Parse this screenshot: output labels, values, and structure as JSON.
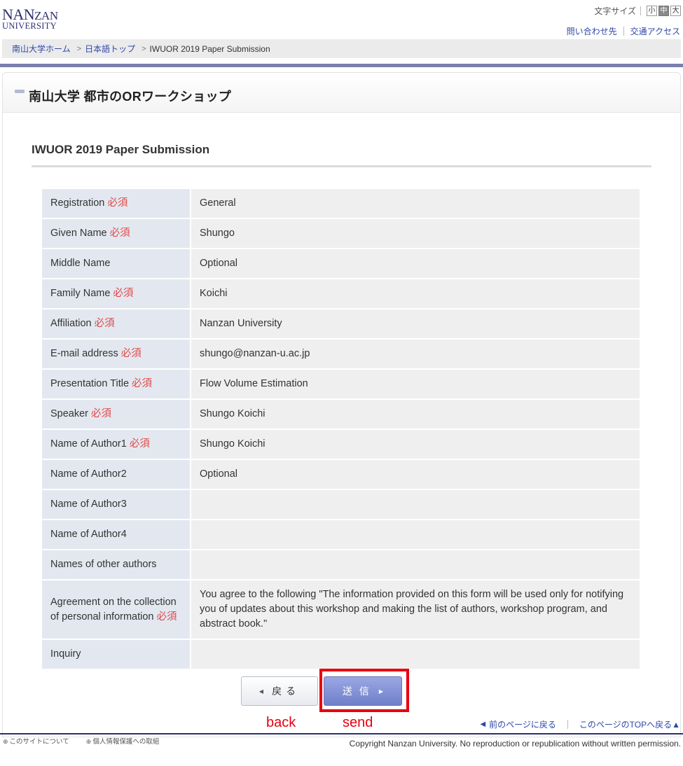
{
  "header": {
    "logo_top": "NANZAN",
    "logo_top_a": "NAN",
    "logo_top_b": "ZAN",
    "logo_bottom": "UNIVERSITY",
    "font_size_label": "文字サイズ",
    "font_sizes": [
      "小",
      "中",
      "大"
    ],
    "contact_link": "問い合わせ先",
    "access_link": "交通アクセス"
  },
  "breadcrumb": {
    "home": "南山大学ホーム",
    "japanese_top": "日本語トップ",
    "current": "IWUOR 2019 Paper Submission",
    "separator": ">"
  },
  "page": {
    "title": "南山大学 都市のORワークショップ",
    "subtitle": "IWUOR 2019 Paper Submission"
  },
  "form": {
    "required_mark": "必須",
    "rows": [
      {
        "label": "Registration",
        "required": true,
        "value": "General"
      },
      {
        "label": "Given Name",
        "required": true,
        "value": "Shungo"
      },
      {
        "label": "Middle Name",
        "required": false,
        "value": "Optional"
      },
      {
        "label": "Family Name",
        "required": true,
        "value": "Koichi"
      },
      {
        "label": "Affiliation",
        "required": true,
        "value": "Nanzan University"
      },
      {
        "label": "E-mail address",
        "required": true,
        "value": "shungo@nanzan-u.ac.jp"
      },
      {
        "label": "Presentation Title",
        "required": true,
        "value": "Flow Volume Estimation"
      },
      {
        "label": "Speaker",
        "required": true,
        "value": "Shungo Koichi"
      },
      {
        "label": "Name of Author1",
        "required": true,
        "value": "Shungo Koichi"
      },
      {
        "label": "Name of Author2",
        "required": false,
        "value": "Optional"
      },
      {
        "label": "Name of Author3",
        "required": false,
        "value": ""
      },
      {
        "label": "Name of Author4",
        "required": false,
        "value": ""
      },
      {
        "label": "Names of other authors",
        "required": false,
        "value": ""
      },
      {
        "label": "Agreement on the collection of personal information",
        "required": true,
        "value": "You agree to the following \"The information provided on this form will be used only for notifying you of updates about this workshop and making the list of authors, workshop program, and abstract book.\""
      },
      {
        "label": "Inquiry",
        "required": false,
        "value": ""
      }
    ]
  },
  "buttons": {
    "back_label": "戻る",
    "send_label": "送信",
    "back_annotation": "back",
    "send_annotation": "send"
  },
  "page_nav": {
    "prev_page": "前のページに戻る",
    "to_top": "このページのTOPへ戻る▲"
  },
  "footer": {
    "about_site": "このサイトについて",
    "privacy": "個人情報保護への取組",
    "copyright": "Copyright Nanzan University. No reproduction or republication without written permission."
  },
  "colors": {
    "brand_navy": "#2e3070",
    "link_blue": "#2f47a8",
    "required_red": "#e04848",
    "annotation_red": "#e8000f",
    "label_bg": "#e3e8f0",
    "value_bg": "#efefef",
    "send_button": "#7d8cd2"
  }
}
